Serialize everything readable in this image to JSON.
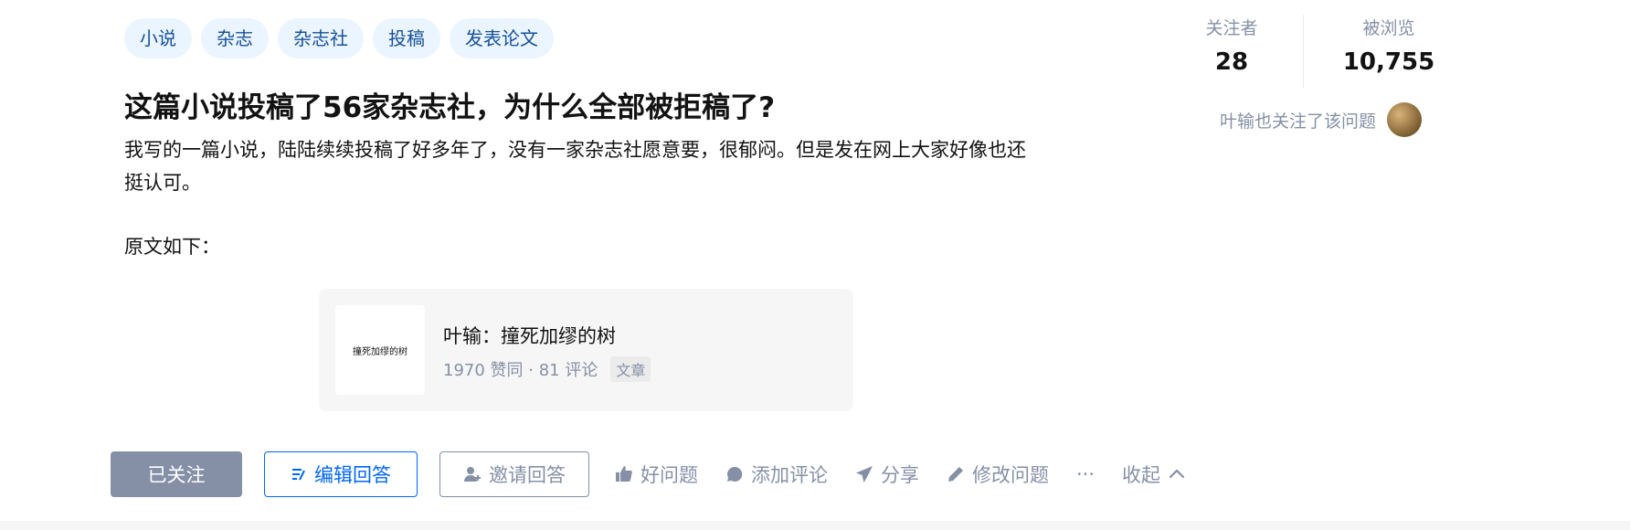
{
  "topics": [
    "小说",
    "杂志",
    "杂志社",
    "投稿",
    "发表论文"
  ],
  "question": {
    "title": "这篇小说投稿了56家杂志社，为什么全部被拒稿了?",
    "desc_line1": "我写的一篇小说，陆陆续续投稿了好多年了，没有一家杂志社愿意要，很郁闷。但是发在网上大家好像也还挺认可。",
    "desc_line2": "原文如下："
  },
  "article_card": {
    "thumb_text": "撞死加缪的树",
    "title": "叶输：撞死加缪的树",
    "meta": "1970 赞同 · 81 评论",
    "badge": "文章"
  },
  "stats": {
    "followers_label": "关注者",
    "followers_value": "28",
    "views_label": "被浏览",
    "views_value": "10,755"
  },
  "follow_note": "叶输也关注了该问题",
  "actions": {
    "followed": "已关注",
    "edit_answer": "编辑回答",
    "invite_answer": "邀请回答",
    "good_question": "好问题",
    "add_comment": "添加评论",
    "share": "分享",
    "edit_question": "修改问题",
    "more": "···",
    "collapse": "收起"
  },
  "colors": {
    "tag_bg": "#ebf5ff",
    "tag_text": "#175199",
    "primary": "#0066ff",
    "muted": "#8590a6"
  }
}
